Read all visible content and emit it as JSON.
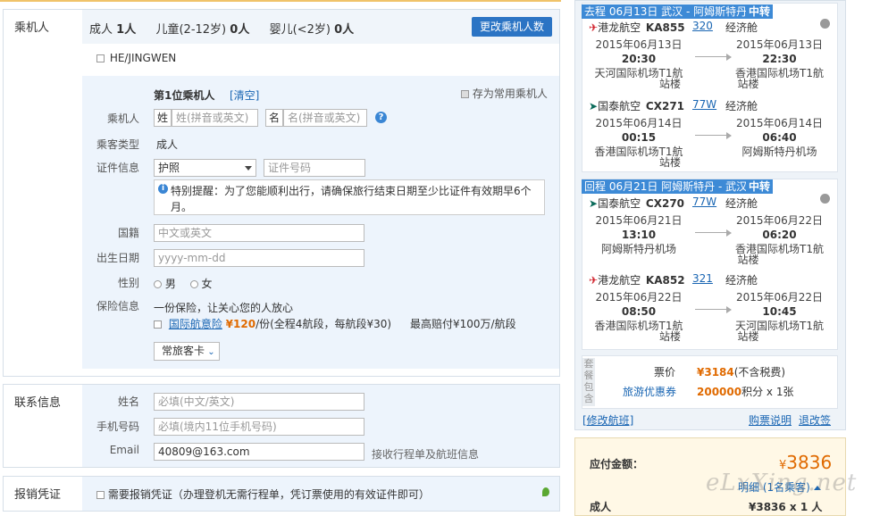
{
  "passengers": {
    "section_label": "乘机人",
    "adult_label": "成人",
    "adult_count": "1人",
    "child_label": "儿童(2-12岁)",
    "child_count": "0人",
    "infant_label": "婴儿(<2岁)",
    "infant_count": "0人",
    "change_button": "更改乘机人数",
    "saved_name": "HE/JINGWEN"
  },
  "form": {
    "title": "第1位乘机人",
    "clear": "[清空]",
    "save_frequent": "存为常用乘机人",
    "passenger_label": "乘机人",
    "surname_tag": "姓",
    "surname_placeholder": "姓(拼音或英文)",
    "given_tag": "名",
    "given_placeholder": "名(拼音或英文)",
    "type_label": "乘客类型",
    "type_value": "成人",
    "id_label": "证件信息",
    "id_type": "护照",
    "id_placeholder": "证件号码",
    "notice_title": "特别提醒：",
    "notice_text": "为了您能顺利出行，请确保旅行结束日期至少比证件有效期早6个",
    "notice_text2": "月。",
    "nationality_label": "国籍",
    "nationality_placeholder": "中文或英文",
    "birth_label": "出生日期",
    "birth_placeholder": "yyyy-mm-dd",
    "gender_label": "性别",
    "male": "男",
    "female": "女",
    "insurance_label": "保险信息",
    "insurance_slogan": "一份保险，让关心您的人放心",
    "insurance_name": "国际航意险",
    "insurance_price": "¥120",
    "insurance_detail": "/份(全程4航段，每航段¥30)",
    "insurance_max": "最高赔付¥100万/航段",
    "frequent_card": "常旅客卡"
  },
  "contact": {
    "section_label": "联系信息",
    "name_label": "姓名",
    "name_placeholder": "必填(中文/英文)",
    "phone_label": "手机号码",
    "phone_placeholder": "必填(境内11位手机号码)",
    "email_label": "Email",
    "email_value": "40809@163.com",
    "email_note": "接收行程单及航班信息"
  },
  "invoice": {
    "section_label": "报销凭证",
    "text": "需要报销凭证（办理登机无需行程单，凭订票使用的有效证件即可）"
  },
  "outbound": {
    "header": "去程 06月13日 武汉 - 阿姆斯特丹",
    "transfer": "中转",
    "flights": [
      {
        "airline": "港龙航空",
        "code": "KA855",
        "plane": "320",
        "cabin": "经济舱",
        "dep_date": "2015年06月13日",
        "dep_time": "20:30",
        "dep_airport": "天河国际机场T1航",
        "dep_airport2": "站楼",
        "arr_date": "2015年06月13日",
        "arr_time": "22:30",
        "arr_airport": "香港国际机场T1航",
        "arr_airport2": "站楼"
      },
      {
        "airline": "国泰航空",
        "code": "CX271",
        "plane": "77W",
        "cabin": "经济舱",
        "dep_date": "2015年06月14日",
        "dep_time": "00:15",
        "dep_airport": "香港国际机场T1航",
        "dep_airport2": "站楼",
        "arr_date": "2015年06月14日",
        "arr_time": "06:40",
        "arr_airport": "阿姆斯特丹机场",
        "arr_airport2": ""
      }
    ]
  },
  "return": {
    "header": "回程 06月21日 阿姆斯特丹 - 武汉",
    "transfer": "中转",
    "flights": [
      {
        "airline": "国泰航空",
        "code": "CX270",
        "plane": "77W",
        "cabin": "经济舱",
        "dep_date": "2015年06月21日",
        "dep_time": "13:10",
        "dep_airport": "阿姆斯特丹机场",
        "dep_airport2": "",
        "arr_date": "2015年06月22日",
        "arr_time": "06:20",
        "arr_airport": "香港国际机场T1航",
        "arr_airport2": "站楼"
      },
      {
        "airline": "港龙航空",
        "code": "KA852",
        "plane": "321",
        "cabin": "经济舱",
        "dep_date": "2015年06月22日",
        "dep_time": "08:50",
        "dep_airport": "香港国际机场T1航",
        "dep_airport2": "站楼",
        "arr_date": "2015年06月22日",
        "arr_time": "10:45",
        "arr_airport": "天河国际机场T1航",
        "arr_airport2": "站楼"
      }
    ]
  },
  "package": {
    "side_label": "套餐包含",
    "price_label": "票价",
    "price_value": "¥3184",
    "price_note": "(不含税费)",
    "coupon_label": "旅游优惠券",
    "coupon_value": "200000",
    "coupon_note": "积分 x 1张"
  },
  "links": {
    "modify": "[修改航班]",
    "rules": "购票说明",
    "refund": "退改签"
  },
  "total": {
    "label": "应付金额：",
    "currency": "¥",
    "amount": "3836",
    "detail": "明细",
    "detail_note": "(1名乘客)",
    "adult_label": "成人",
    "adult_value": "¥3836 x 1 人"
  },
  "watermark": "eLxXing.net",
  "colors": {
    "accent": "#1a66b3",
    "header_bar": "#3d8ad6",
    "price": "#e06a00",
    "form_bg": "#edf4fc"
  }
}
